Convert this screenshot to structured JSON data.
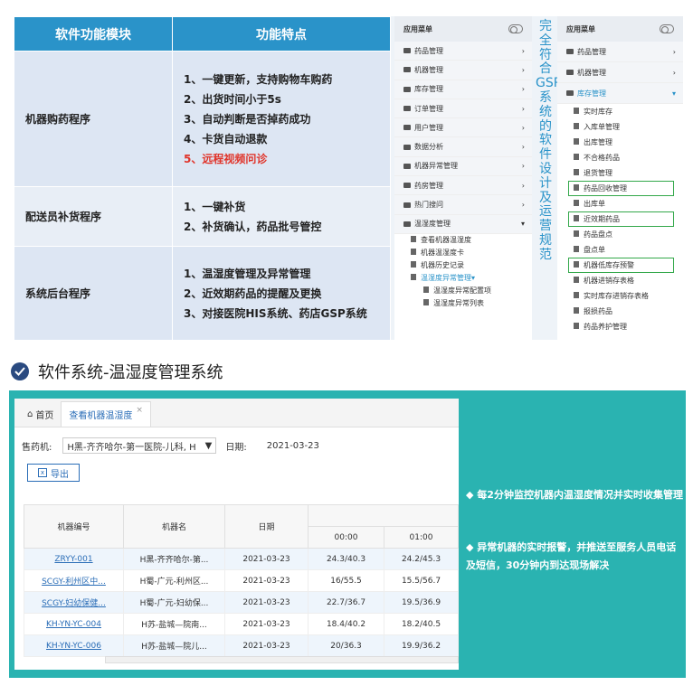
{
  "feature_table": {
    "headers": [
      "软件功能模块",
      "功能特点"
    ],
    "rows": [
      {
        "module": "机器购药程序",
        "features": [
          "1、一键更新，支持购物车购药",
          "2、出货时间小于5s",
          "3、自动判断是否掉药成功",
          "4、卡货自动退款"
        ],
        "red_feature": "5、远程视频问诊"
      },
      {
        "module": "配送员补货程序",
        "features": [
          "1、一键补货",
          "2、补货确认，药品批号管控"
        ]
      },
      {
        "module": "系统后台程序",
        "features": [
          "1、温湿度管理及异常管理",
          "2、近效期药品的提醒及更换",
          "3、对接医院HIS系统、药店GSP系统"
        ]
      }
    ]
  },
  "menu1": {
    "title": "应用菜单",
    "items": [
      "药品管理",
      "机器管理",
      "库存管理",
      "订单管理",
      "用户管理",
      "数据分析",
      "机器异常管理",
      "药房管理",
      "热门搜问",
      "温湿度管理"
    ],
    "subitems": [
      "查看机器温湿度",
      "机器温湿度卡",
      "机器历史记录"
    ],
    "active": "温湿度异常管理",
    "subsub": [
      "温湿度异常配置项",
      "温湿度异常列表"
    ]
  },
  "vertical_text": "完全符合GSP系统的软件设计及运营规范",
  "menu2": {
    "title": "应用菜单",
    "items": [
      "药品管理",
      "机器管理"
    ],
    "active": "库存管理",
    "subitems": [
      "实时库存",
      "入库单管理",
      "出库管理",
      "不合格药品",
      "退货管理",
      "药品回收管理",
      "出库单",
      "近效期药品",
      "药品盘点",
      "盘点单",
      "机器低库存预警",
      "机器进销存表格",
      "实时库存进销存表格",
      "报损药品",
      "药品养护管理"
    ],
    "highlighted": [
      "药品回收管理",
      "近效期药品",
      "机器低库存预警"
    ]
  },
  "section_title": "软件系统-温湿度管理系统",
  "app": {
    "tabs": {
      "home": "首页",
      "current": "查看机器温湿度",
      "close": "×"
    },
    "filters": {
      "machine_label": "售药机:",
      "machine_value": "H黑-齐齐哈尔-第一医院-儿科, H",
      "date_label": "日期:",
      "date_value": "2021-03-23"
    },
    "export_label": "导出",
    "columns": {
      "code": "机器编号",
      "name": "机器名",
      "date": "日期",
      "t1": "00:00",
      "t2": "01:00"
    },
    "rows": [
      {
        "code": "ZRYY-001",
        "name": "H黑-齐齐哈尔-第...",
        "date": "2021-03-23",
        "t1": "24.3/40.3",
        "t2": "24.2/45.3"
      },
      {
        "code": "SCGY-利州区中...",
        "name": "H蜀-广元-利州区...",
        "date": "2021-03-23",
        "t1": "16/55.5",
        "t2": "15.5/56.7"
      },
      {
        "code": "SCGY-妇幼保健...",
        "name": "H蜀-广元-妇幼保...",
        "date": "2021-03-23",
        "t1": "22.7/36.7",
        "t2": "19.5/36.9"
      },
      {
        "code": "KH-YN-YC-004",
        "name": "H苏-盐城—院南...",
        "date": "2021-03-23",
        "t1": "18.4/40.2",
        "t2": "18.2/40.5"
      },
      {
        "code": "KH-YN-YC-006",
        "name": "H苏-盐城—院儿...",
        "date": "2021-03-23",
        "t1": "20/36.3",
        "t2": "19.9/36.2"
      }
    ]
  },
  "bullets": [
    "◆ 每2分钟监控机器内温湿度情况并实时收集管理",
    "◆ 异常机器的实时报警，并推送至服务人员电话及短信，30分钟内到达现场解决"
  ]
}
